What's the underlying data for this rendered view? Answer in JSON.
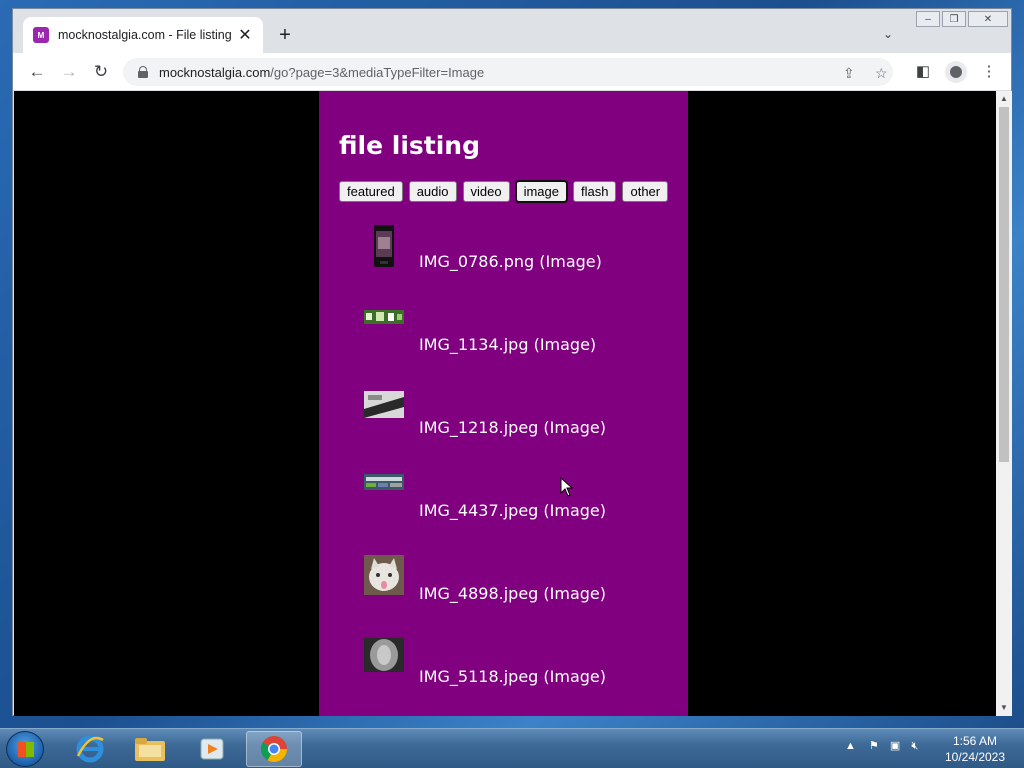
{
  "browser": {
    "tab_title": "mocknostalgia.com - File listing",
    "favicon_text": "M",
    "url_host": "mocknostalgia.com",
    "url_path": "/go?page=3&mediaTypeFilter=Image"
  },
  "page": {
    "heading": "file listing",
    "filters": [
      {
        "label": "featured",
        "active": false
      },
      {
        "label": "audio",
        "active": false
      },
      {
        "label": "video",
        "active": false
      },
      {
        "label": "image",
        "active": true
      },
      {
        "label": "flash",
        "active": false
      },
      {
        "label": "other",
        "active": false
      }
    ],
    "files": [
      {
        "name": "IMG_0786.png (Image)",
        "thumb": "phone-photo"
      },
      {
        "name": "IMG_1134.jpg (Image)",
        "thumb": "banner-photo"
      },
      {
        "name": "IMG_1218.jpeg (Image)",
        "thumb": "device-photo"
      },
      {
        "name": "IMG_4437.jpeg (Image)",
        "thumb": "screen-photo"
      },
      {
        "name": "IMG_4898.jpeg (Image)",
        "thumb": "cat-photo"
      },
      {
        "name": "IMG_5118.jpeg (Image)",
        "thumb": "xray-photo"
      }
    ],
    "colors": {
      "background": "#000000",
      "column": "#800080",
      "text": "#ffffff"
    }
  },
  "taskbar": {
    "time": "1:56 AM",
    "date": "10/24/2023"
  }
}
